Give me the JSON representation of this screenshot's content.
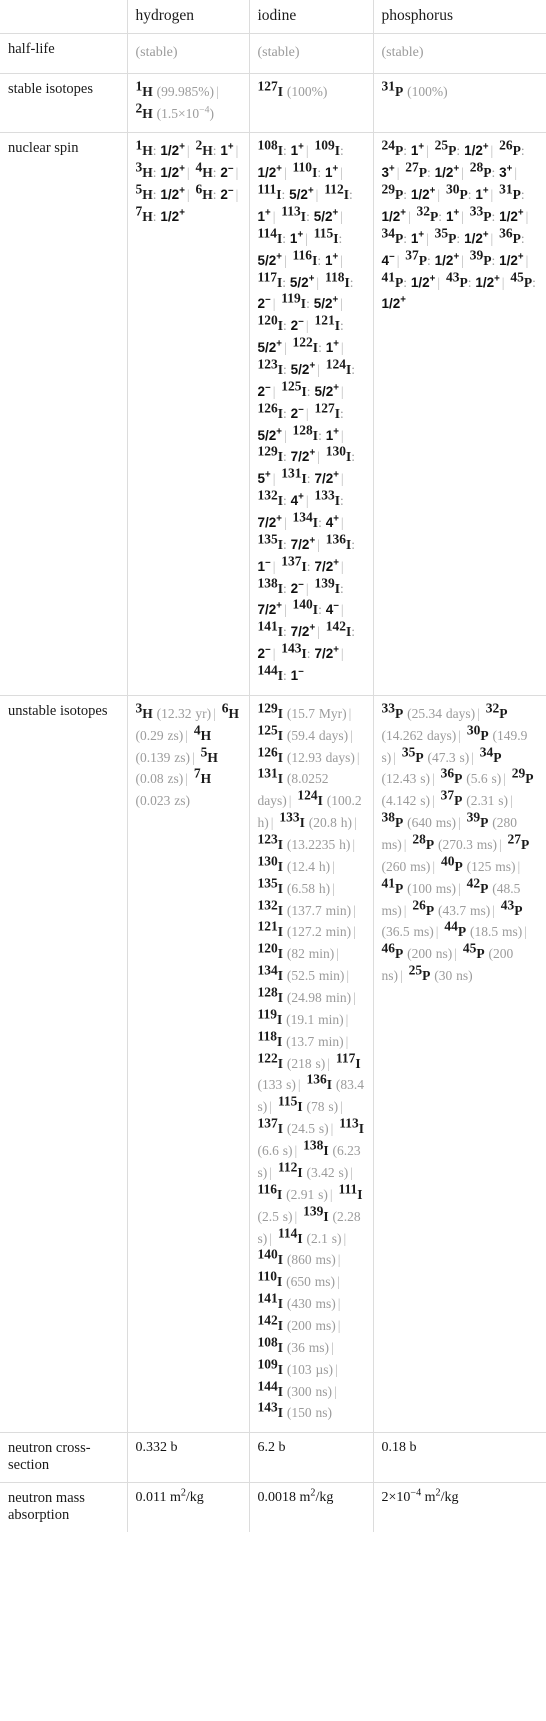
{
  "table": {
    "columns": [
      "",
      "hydrogen",
      "iodine",
      "phosphorus"
    ],
    "row_labels": {
      "half_life": "half-life",
      "stable_isotopes": "stable isotopes",
      "nuclear_spin": "nuclear spin",
      "unstable_isotopes": "unstable isotopes",
      "neutron_cross_section": "neutron cross-section",
      "neutron_mass_absorption": "neutron mass absorption"
    },
    "rows": {
      "half_life": {
        "hydrogen": "(stable)",
        "iodine": "(stable)",
        "phosphorus": "(stable)"
      },
      "stable_isotopes": {
        "hydrogen": "1H (99.985%) | 2H (1.5×10^-4)",
        "iodine": "127I (100%)",
        "phosphorus": "31P (100%)"
      },
      "nuclear_spin": {
        "hydrogen": "1H: 1/2+ | 2H: 1+ | 3H: 1/2+ | 4H: 2- | 5H: 1/2+ | 6H: 2- | 7H: 1/2+",
        "iodine": "108I: 1+ | 109I: 1/2+ | 110I: 1+ | 111I: 5/2+ | 112I: 1+ | 113I: 5/2+ | 114I: 1+ | 115I: 5/2+ | 116I: 1+ | 117I: 5/2+ | 118I: 2- | 119I: 5/2+ | 120I: 2- | 121I: 5/2+ | 122I: 1+ | 123I: 5/2+ | 124I: 2- | 125I: 5/2+ | 126I: 2- | 127I: 5/2+ | 128I: 1+ | 129I: 7/2+ | 130I: 5+ | 131I: 7/2+ | 132I: 4+ | 133I: 7/2+ | 134I: 4+ | 135I: 7/2+ | 136I: 1- | 137I: 7/2+ | 138I: 2- | 139I: 7/2+ | 140I: 4- | 141I: 7/2+ | 142I: 2- | 143I: 7/2+ | 144I: 1-",
        "phosphorus": "24P: 1+ | 25P: 1/2+ | 26P: 3+ | 27P: 1/2+ | 28P: 3+ | 29P: 1/2+ | 30P: 1+ | 31P: 1/2+ | 32P: 1+ | 33P: 1/2+ | 34P: 1+ | 35P: 1/2+ | 36P: 4- | 37P: 1/2+ | 39P: 1/2+ | 41P: 1/2+ | 43P: 1/2+ | 45P: 1/2+"
      },
      "unstable_isotopes": {
        "hydrogen": "3H (12.32 yr) | 6H (0.29 zs) | 4H (0.139 zs) | 5H (0.08 zs) | 7H (0.023 zs)",
        "iodine": "129I (15.7 Myr) | 125I (59.4 days) | 126I (12.93 days) | 131I (8.0252 days) | 124I (100.2 h) | 133I (20.8 h) | 123I (13.2235 h) | 130I (12.4 h) | 135I (6.58 h) | 132I (137.7 min) | 121I (127.2 min) | 120I (82 min) | 134I (52.5 min) | 128I (24.98 min) | 119I (19.1 min) | 118I (13.7 min) | 122I (218 s) | 117I (133 s) | 136I (83.4 s) | 115I (78 s) | 137I (24.5 s) | 113I (6.6 s) | 138I (6.23 s) | 112I (3.42 s) | 116I (2.91 s) | 111I (2.5 s) | 139I (2.28 s) | 114I (2.1 s) | 140I (860 ms) | 110I (650 ms) | 141I (430 ms) | 142I (200 ms) | 108I (36 ms) | 109I (103 µs) | 144I (300 ns) | 143I (150 ns)",
        "phosphorus": "33P (25.34 days) | 32P (14.262 days) | 30P (149.9 s) | 35P (47.3 s) | 34P (12.43 s) | 36P (5.6 s) | 29P (4.142 s) | 37P (2.31 s) | 38P (640 ms) | 39P (280 ms) | 28P (270.3 ms) | 27P (260 ms) | 40P (125 ms) | 41P (100 ms) | 42P (48.5 ms) | 26P (43.7 ms) | 43P (36.5 ms) | 44P (18.5 ms) | 46P (200 ns) | 45P (200 ns) | 25P (30 ns)"
      },
      "neutron_cross_section": {
        "hydrogen": "0.332 b",
        "iodine": "6.2 b",
        "phosphorus": "0.18 b"
      },
      "neutron_mass_absorption": {
        "hydrogen": "0.011 m^2/kg",
        "iodine": "0.0018 m^2/kg",
        "phosphorus": "2×10^-4 m^2/kg"
      }
    }
  },
  "colors": {
    "border": "#dcdcdc",
    "muted_text": "#9b9b9b",
    "primary_text": "#1a1a1a"
  }
}
